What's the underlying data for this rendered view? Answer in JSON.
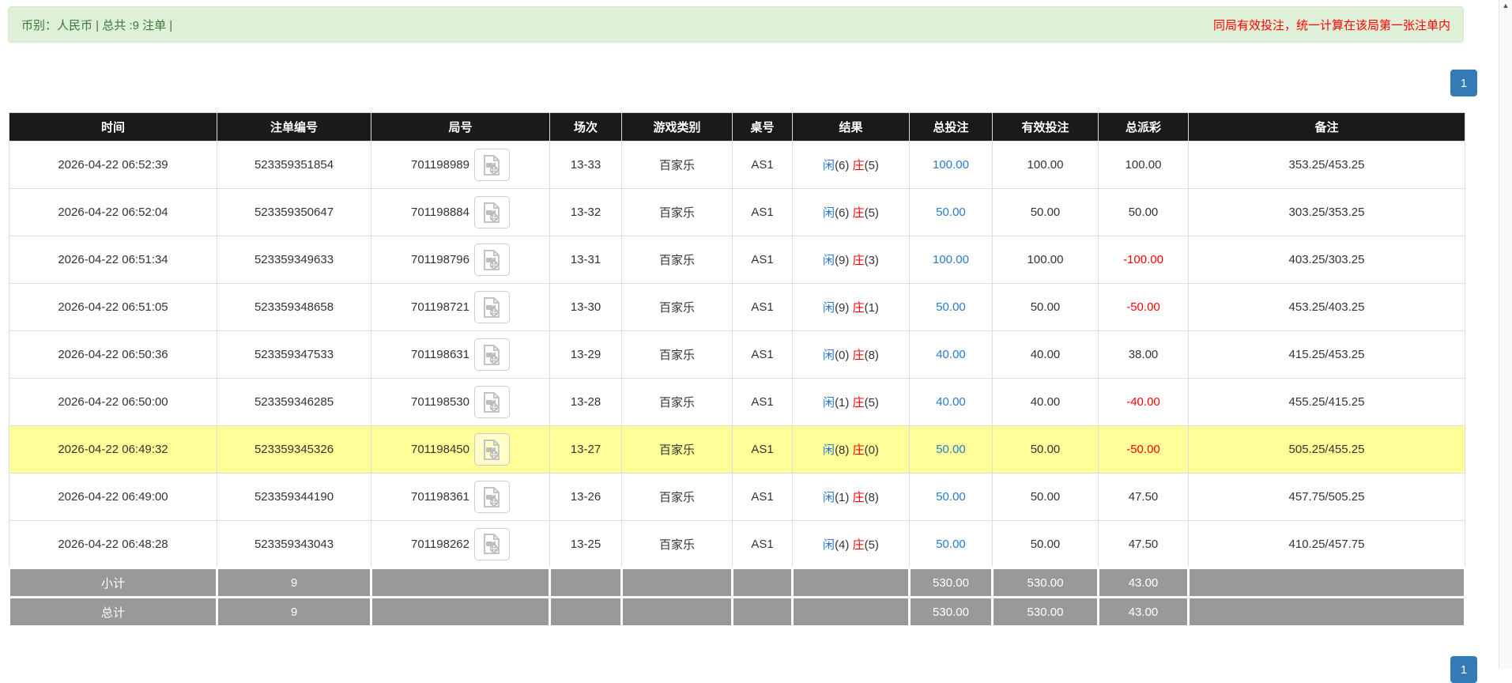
{
  "top_bar": {
    "left_text": "币别：人民币 | 总共 :9 注单 |",
    "right_text": "同局有效投注，统一计算在该局第一张注单内"
  },
  "pagination": {
    "page": "1"
  },
  "icons": {
    "video_icon": "video-file-icon",
    "scroll_up_glyph": "▲"
  },
  "colors": {
    "bar_green_bg": "#dff0d8",
    "bar_green_text": "#3c763d",
    "notice_red": "#ff0000",
    "header_black": "#1a1a1a",
    "accent_blue": "#2a7ad2",
    "negative_red": "#ff0000",
    "highlight_yellow": "#ffff99",
    "footer_gray": "#999999",
    "pager_blue": "#337ab7"
  },
  "table": {
    "headers": [
      "时间",
      "注单编号",
      "局号",
      "场次",
      "游戏类别",
      "桌号",
      "结果",
      "总投注",
      "有效投注",
      "总派彩",
      "备注"
    ],
    "rows": [
      {
        "time": "2026-04-22 06:52:39",
        "bet_id": "523359351854",
        "round": "701198989",
        "session": "13-33",
        "game": "百家乐",
        "table_no": "AS1",
        "rp": "闲",
        "rpv": "(6)",
        "rb": "庄",
        "rbv": "(5)",
        "total_bet": "100.00",
        "valid_bet": "100.00",
        "payout": "100.00",
        "remark": "353.25/453.25",
        "highlight": false
      },
      {
        "time": "2026-04-22 06:52:04",
        "bet_id": "523359350647",
        "round": "701198884",
        "session": "13-32",
        "game": "百家乐",
        "table_no": "AS1",
        "rp": "闲",
        "rpv": "(6)",
        "rb": "庄",
        "rbv": "(5)",
        "total_bet": "50.00",
        "valid_bet": "50.00",
        "payout": "50.00",
        "remark": "303.25/353.25",
        "highlight": false
      },
      {
        "time": "2026-04-22 06:51:34",
        "bet_id": "523359349633",
        "round": "701198796",
        "session": "13-31",
        "game": "百家乐",
        "table_no": "AS1",
        "rp": "闲",
        "rpv": "(9)",
        "rb": "庄",
        "rbv": "(3)",
        "total_bet": "100.00",
        "valid_bet": "100.00",
        "payout": "-100.00",
        "remark": "403.25/303.25",
        "highlight": false
      },
      {
        "time": "2026-04-22 06:51:05",
        "bet_id": "523359348658",
        "round": "701198721",
        "session": "13-30",
        "game": "百家乐",
        "table_no": "AS1",
        "rp": "闲",
        "rpv": "(9)",
        "rb": "庄",
        "rbv": "(1)",
        "total_bet": "50.00",
        "valid_bet": "50.00",
        "payout": "-50.00",
        "remark": "453.25/403.25",
        "highlight": false
      },
      {
        "time": "2026-04-22 06:50:36",
        "bet_id": "523359347533",
        "round": "701198631",
        "session": "13-29",
        "game": "百家乐",
        "table_no": "AS1",
        "rp": "闲",
        "rpv": "(0)",
        "rb": "庄",
        "rbv": "(8)",
        "total_bet": "40.00",
        "valid_bet": "40.00",
        "payout": "38.00",
        "remark": "415.25/453.25",
        "highlight": false
      },
      {
        "time": "2026-04-22 06:50:00",
        "bet_id": "523359346285",
        "round": "701198530",
        "session": "13-28",
        "game": "百家乐",
        "table_no": "AS1",
        "rp": "闲",
        "rpv": "(1)",
        "rb": "庄",
        "rbv": "(5)",
        "total_bet": "40.00",
        "valid_bet": "40.00",
        "payout": "-40.00",
        "remark": "455.25/415.25",
        "highlight": false
      },
      {
        "time": "2026-04-22 06:49:32",
        "bet_id": "523359345326",
        "round": "701198450",
        "session": "13-27",
        "game": "百家乐",
        "table_no": "AS1",
        "rp": "闲",
        "rpv": "(8)",
        "rb": "庄",
        "rbv": "(0)",
        "total_bet": "50.00",
        "valid_bet": "50.00",
        "payout": "-50.00",
        "remark": "505.25/455.25",
        "highlight": true
      },
      {
        "time": "2026-04-22 06:49:00",
        "bet_id": "523359344190",
        "round": "701198361",
        "session": "13-26",
        "game": "百家乐",
        "table_no": "AS1",
        "rp": "闲",
        "rpv": "(1)",
        "rb": "庄",
        "rbv": "(8)",
        "total_bet": "50.00",
        "valid_bet": "50.00",
        "payout": "47.50",
        "remark": "457.75/505.25",
        "highlight": false
      },
      {
        "time": "2026-04-22 06:48:28",
        "bet_id": "523359343043",
        "round": "701198262",
        "session": "13-25",
        "game": "百家乐",
        "table_no": "AS1",
        "rp": "闲",
        "rpv": "(4)",
        "rb": "庄",
        "rbv": "(5)",
        "total_bet": "50.00",
        "valid_bet": "50.00",
        "payout": "47.50",
        "remark": "410.25/457.75",
        "highlight": false
      }
    ],
    "subtotal": {
      "label": "小计",
      "count": "9",
      "total_bet": "530.00",
      "valid_bet": "530.00",
      "payout": "43.00"
    },
    "total": {
      "label": "总计",
      "count": "9",
      "total_bet": "530.00",
      "valid_bet": "530.00",
      "payout": "43.00"
    }
  }
}
